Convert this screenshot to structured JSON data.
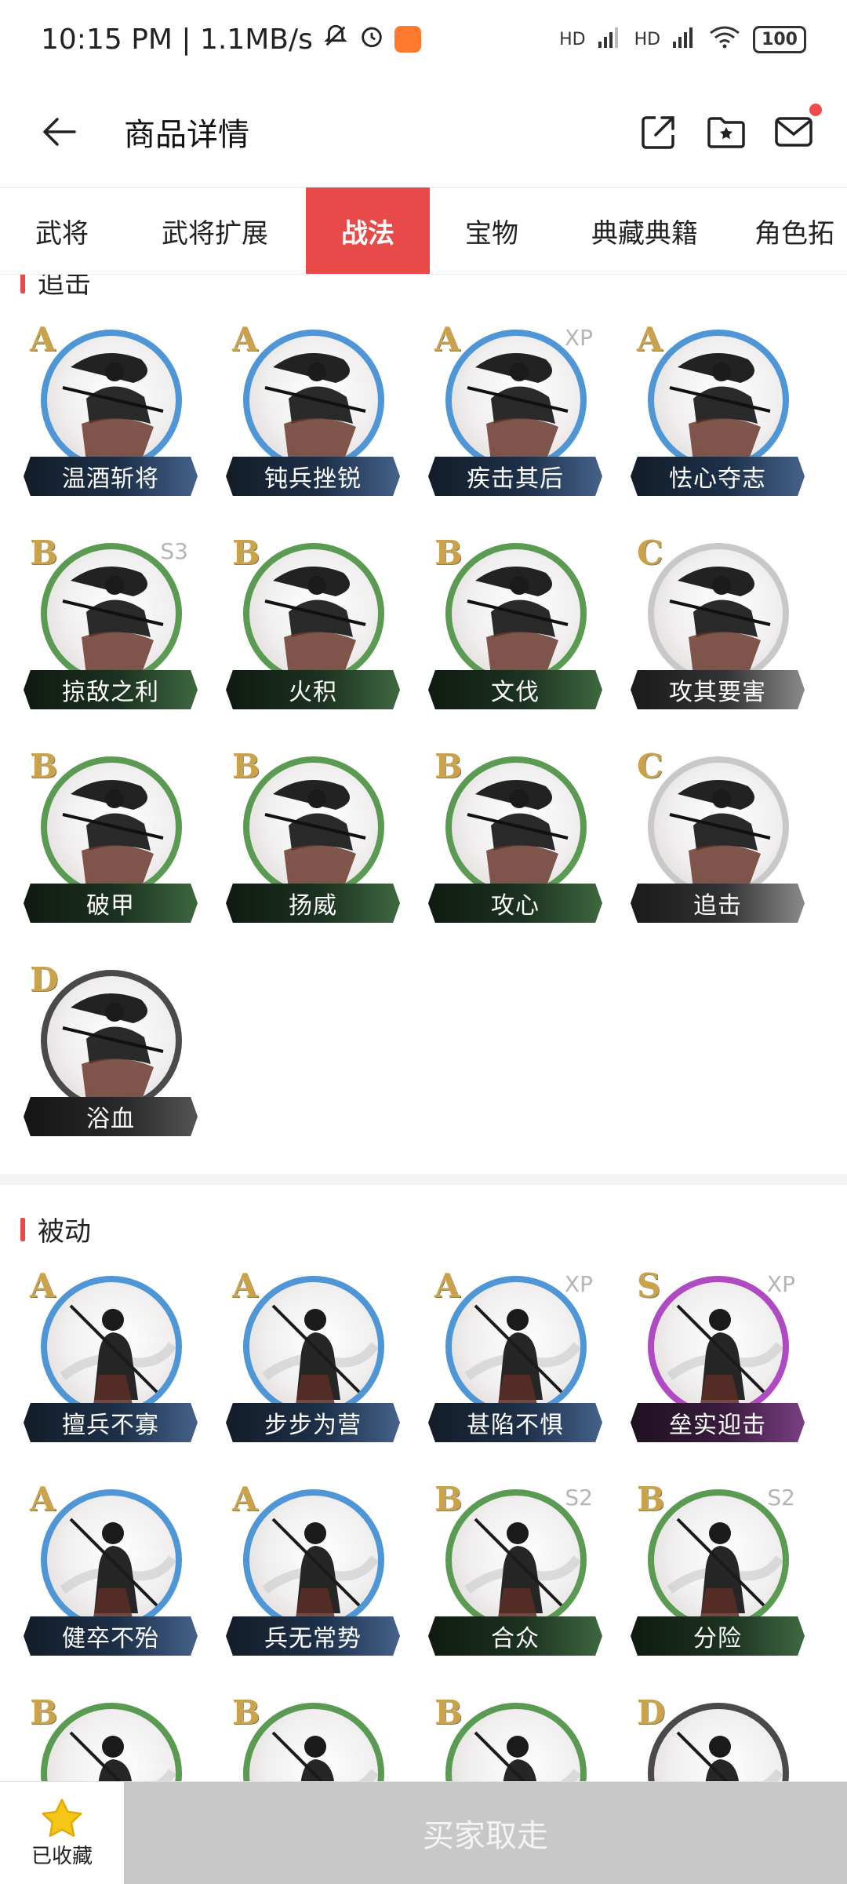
{
  "status_bar": {
    "time_speed": "10:15 PM | 1.1MB/s",
    "signal1": "HD",
    "signal2": "HD",
    "wifi_label": "6",
    "battery": "100"
  },
  "header": {
    "title": "商品详情",
    "icons": [
      "back-arrow-icon",
      "share-icon",
      "folder-star-icon",
      "mail-icon"
    ]
  },
  "tabs": [
    {
      "label": "武将",
      "active": false
    },
    {
      "label": "武将扩展",
      "active": false
    },
    {
      "label": "战法",
      "active": true
    },
    {
      "label": "宝物",
      "active": false
    },
    {
      "label": "典藏典籍",
      "active": false
    },
    {
      "label": "角色拓",
      "active": false
    }
  ],
  "colors": {
    "accent": "#e84a4a",
    "A": "#4e96d6",
    "B": "#5a9a52",
    "C": "#c8c8c8",
    "D": "#4a4a4a",
    "S": "#b04ac2"
  },
  "sections": [
    {
      "title": "追击",
      "skills": [
        {
          "grade": "A",
          "name": "温酒斩将",
          "tag": ""
        },
        {
          "grade": "A",
          "name": "钝兵挫锐",
          "tag": ""
        },
        {
          "grade": "A",
          "name": "疾击其后",
          "tag": "XP"
        },
        {
          "grade": "A",
          "name": "怯心夺志",
          "tag": ""
        },
        {
          "grade": "B",
          "name": "掠敌之利",
          "tag": "S3"
        },
        {
          "grade": "B",
          "name": "火积",
          "tag": ""
        },
        {
          "grade": "B",
          "name": "文伐",
          "tag": ""
        },
        {
          "grade": "C",
          "name": "攻其要害",
          "tag": ""
        },
        {
          "grade": "B",
          "name": "破甲",
          "tag": ""
        },
        {
          "grade": "B",
          "name": "扬威",
          "tag": ""
        },
        {
          "grade": "B",
          "name": "攻心",
          "tag": ""
        },
        {
          "grade": "C",
          "name": "追击",
          "tag": ""
        },
        {
          "grade": "D",
          "name": "浴血",
          "tag": ""
        }
      ]
    },
    {
      "title": "被动",
      "skills": [
        {
          "grade": "A",
          "name": "擅兵不寡",
          "tag": ""
        },
        {
          "grade": "A",
          "name": "步步为营",
          "tag": ""
        },
        {
          "grade": "A",
          "name": "甚陷不惧",
          "tag": "XP"
        },
        {
          "grade": "S",
          "name": "垒实迎击",
          "tag": "XP"
        },
        {
          "grade": "A",
          "name": "健卒不殆",
          "tag": ""
        },
        {
          "grade": "A",
          "name": "兵无常势",
          "tag": ""
        },
        {
          "grade": "B",
          "name": "合众",
          "tag": "S2"
        },
        {
          "grade": "B",
          "name": "分险",
          "tag": "S2"
        },
        {
          "grade": "B",
          "name": "",
          "tag": ""
        },
        {
          "grade": "B",
          "name": "",
          "tag": ""
        },
        {
          "grade": "B",
          "name": "",
          "tag": ""
        },
        {
          "grade": "D",
          "name": "",
          "tag": ""
        }
      ]
    }
  ],
  "bottom_bar": {
    "favorite_label": "已收藏",
    "buy_label": "买家取走"
  }
}
